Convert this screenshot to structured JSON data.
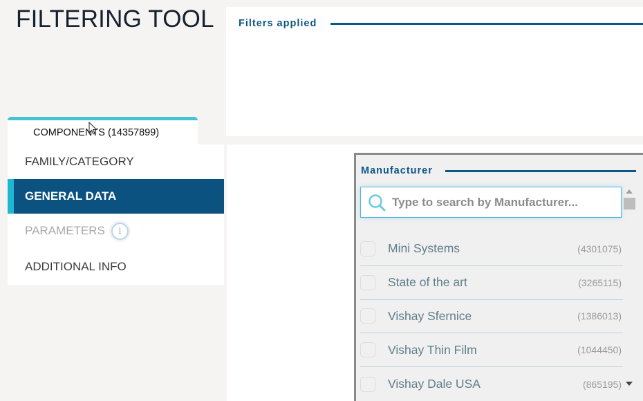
{
  "page": {
    "title": "FILTERING TOOL"
  },
  "filters_panel": {
    "title": "Filters applied"
  },
  "components_tab": {
    "label": "COMPONENTS (14357899)"
  },
  "side_nav": {
    "items": [
      {
        "label": "FAMILY/CATEGORY",
        "state": "normal"
      },
      {
        "label": "GENERAL DATA",
        "state": "active"
      },
      {
        "label": "PARAMETERS",
        "state": "disabled",
        "icon": "info-icon"
      },
      {
        "label": "ADDITIONAL INFO",
        "state": "normal"
      }
    ]
  },
  "manufacturer": {
    "title": "Manufacturer",
    "search": {
      "placeholder": "Type to search by Manufacturer...",
      "value": "",
      "icon": "search-icon"
    },
    "items": [
      {
        "name": "Mini Systems",
        "count": "(4301075)",
        "checked": false
      },
      {
        "name": "State of the art",
        "count": "(3265115)",
        "checked": false
      },
      {
        "name": "Vishay Sfernice",
        "count": "(1386013)",
        "checked": false
      },
      {
        "name": "Vishay Thin Film",
        "count": "(1044450)",
        "checked": false
      },
      {
        "name": "Vishay Dale USA",
        "count": "(865195)",
        "checked": false
      }
    ]
  },
  "colors": {
    "primary": "#0b5280",
    "accent": "#1fb6cf",
    "tab_accent": "#44c3d5",
    "search_border": "#4cb5e6"
  }
}
